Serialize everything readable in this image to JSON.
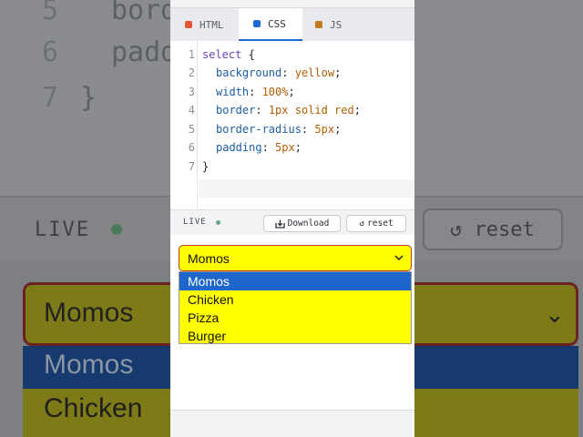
{
  "background": {
    "lines": [
      {
        "num": "5",
        "text": "bord"
      },
      {
        "num": "6",
        "text": "padd"
      },
      {
        "num": "7",
        "text": "}"
      }
    ],
    "live_label": "LIVE",
    "reset_label": "↺ reset",
    "select_value": "Momos",
    "options": [
      "Momos",
      "Chicken"
    ]
  },
  "tabs": [
    {
      "label": "HTML",
      "color": "#e2552f",
      "active": false
    },
    {
      "label": "CSS",
      "color": "#1d6ad6",
      "active": true
    },
    {
      "label": "JS",
      "color": "#c27a1c",
      "active": false
    }
  ],
  "editor": {
    "line_numbers": [
      "1",
      "2",
      "3",
      "4",
      "5",
      "6",
      "7"
    ],
    "lines": [
      {
        "selector": "select",
        "rest": " {"
      },
      {
        "prop": "background",
        "value": "yellow"
      },
      {
        "prop": "width",
        "value": "100%"
      },
      {
        "prop": "border",
        "value": "1px solid red"
      },
      {
        "prop": "border-radius",
        "value": "5px"
      },
      {
        "prop": "padding",
        "value": "5px"
      },
      {
        "selector": "}",
        "rest": ""
      }
    ]
  },
  "live": {
    "label": "LIVE",
    "download_label": "Download",
    "reset_label": "reset",
    "download_icon": "download-icon",
    "reset_icon": "reset-icon"
  },
  "preview": {
    "select_value": "Momos",
    "options": [
      "Momos",
      "Chicken",
      "Pizza",
      "Burger"
    ],
    "selected_option": "Momos",
    "select_bg": "#ffff00",
    "select_border": "#c0392b",
    "highlight": "#1f66cc"
  }
}
